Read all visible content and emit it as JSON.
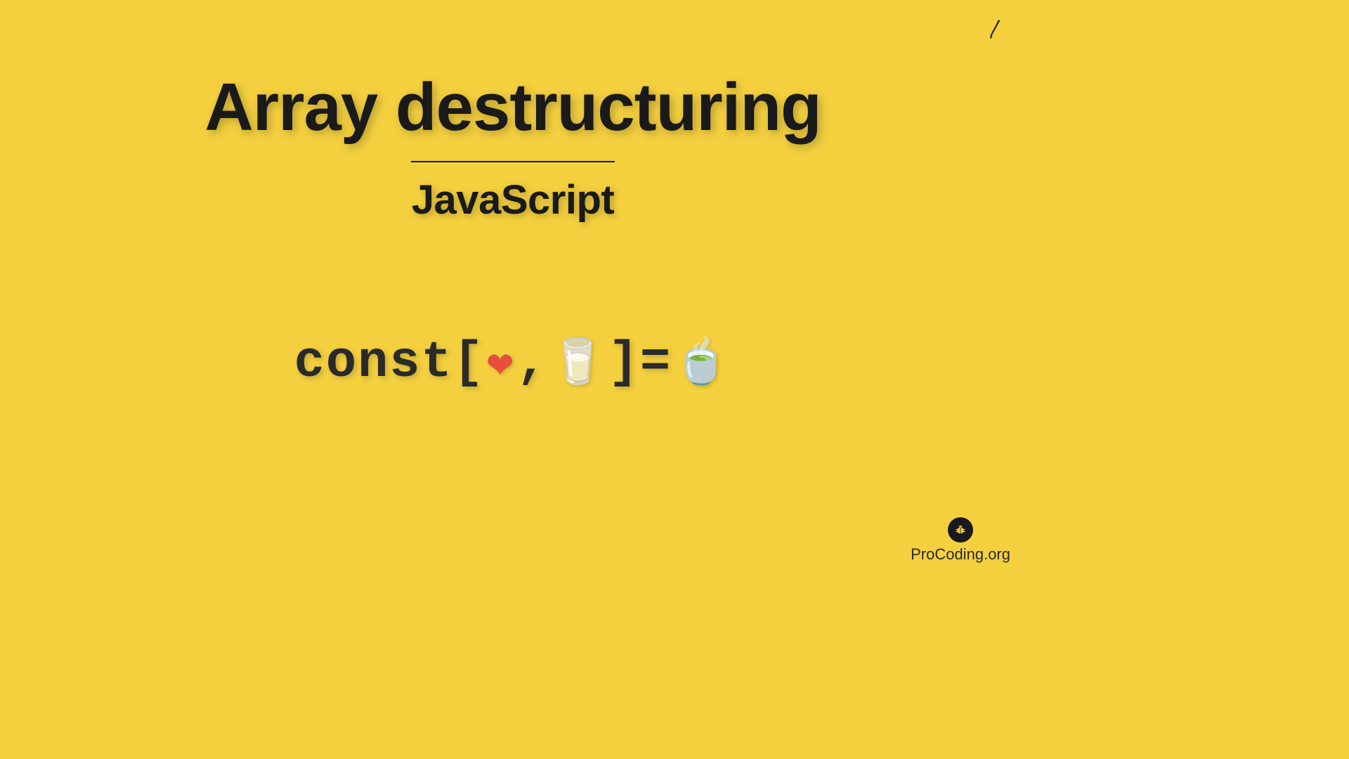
{
  "title": "Array destructuring",
  "subtitle": "JavaScript",
  "code": {
    "keyword": "const ",
    "bracket_open": "[",
    "heart": "❤",
    "comma": ", ",
    "glass": "🥛",
    "bracket_close": "] ",
    "equals": "= ",
    "matcha": "🍵"
  },
  "brand": "ProCoding.org",
  "logo_glyph": "🪲",
  "corner": "〳"
}
